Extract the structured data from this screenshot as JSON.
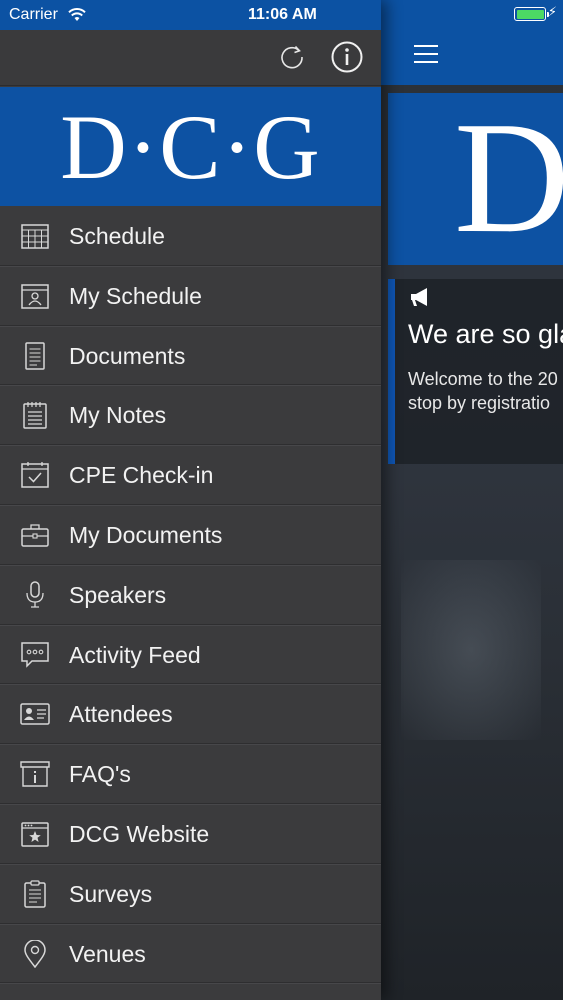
{
  "status_bar": {
    "carrier": "Carrier",
    "time": "11:06 AM"
  },
  "toolbar": {
    "refresh_icon": "refresh-icon",
    "info_icon": "info-icon"
  },
  "banner": {
    "logo_text": "D·C·G"
  },
  "menu": {
    "items": [
      {
        "label": "Schedule",
        "icon": "calendar-grid-icon"
      },
      {
        "label": "My Schedule",
        "icon": "calendar-person-icon"
      },
      {
        "label": "Documents",
        "icon": "document-icon"
      },
      {
        "label": "My Notes",
        "icon": "notepad-icon"
      },
      {
        "label": "CPE Check-in",
        "icon": "calendar-check-icon"
      },
      {
        "label": "My Documents",
        "icon": "briefcase-icon"
      },
      {
        "label": "Speakers",
        "icon": "microphone-icon"
      },
      {
        "label": "Activity Feed",
        "icon": "chat-bubble-icon"
      },
      {
        "label": "Attendees",
        "icon": "id-card-icon"
      },
      {
        "label": "FAQ's",
        "icon": "info-box-icon"
      },
      {
        "label": "DCG Website",
        "icon": "browser-star-icon"
      },
      {
        "label": "Surveys",
        "icon": "clipboard-icon"
      },
      {
        "label": "Venues",
        "icon": "map-pin-icon"
      }
    ]
  },
  "content": {
    "banner_text": "D",
    "announcement": {
      "title": "We are so gla",
      "body_line1": "Welcome to the 20",
      "body_line2": "stop by registratio"
    }
  },
  "colors": {
    "brand_blue": "#0c52a3",
    "drawer_bg": "#3b3b3d",
    "battery_green": "#4cd964"
  }
}
